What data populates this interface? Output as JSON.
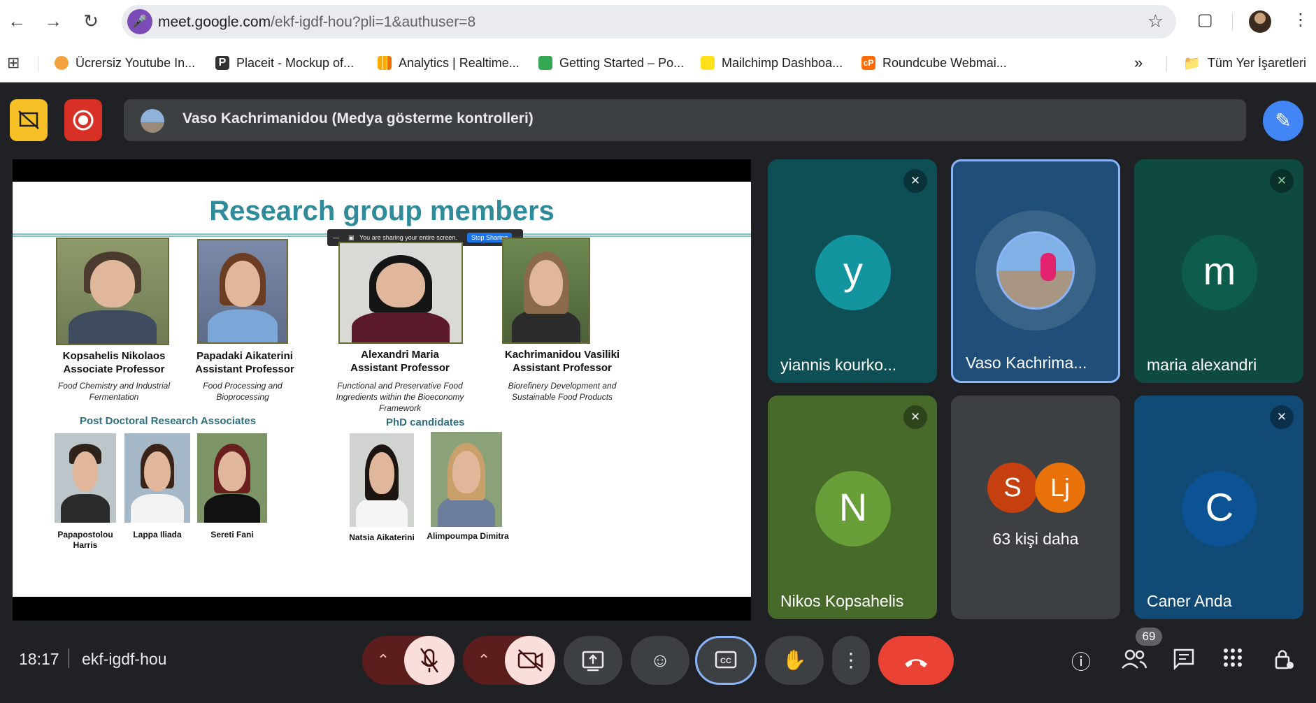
{
  "browser": {
    "url_host": "meet.google.com",
    "url_path": "/ekf-igdf-hou?pli=1&authuser=8",
    "bookmarks": [
      {
        "label": "Ücrersiz Youtube In...",
        "color": "#f4a340"
      },
      {
        "label": "Placeit - Mockup of...",
        "color": "#333333"
      },
      {
        "label": "Analytics | Realtime...",
        "color": "#f9ab00"
      },
      {
        "label": "Getting Started – Po...",
        "color": "#34a853"
      },
      {
        "label": "Mailchimp Dashboa...",
        "color": "#ffe01b"
      },
      {
        "label": "Roundcube Webmai...",
        "color": "#ff6b00"
      }
    ],
    "all_bookmarks": "Tüm Yer İşaretleri"
  },
  "meet": {
    "banner_text": "Vaso Kachrimanidou (Medya gösterme kontrolleri)",
    "slide": {
      "title": "Research group members",
      "share_notice": "You are sharing your entire screen.",
      "stop_sharing": "Stop Sharing",
      "professors": [
        {
          "name": "Kopsahelis Nikolaos",
          "title": "Associate Professor",
          "field": "Food Chemistry and Industrial Fermentation"
        },
        {
          "name": "Papadaki Aikaterini",
          "title": "Assistant Professor",
          "field": "Food Processing and Bioprocessing"
        },
        {
          "name": "Alexandri Maria",
          "title": "Assistant Professor",
          "field": "Functional and Preservative Food Ingredients within the Bioeconomy Framework"
        },
        {
          "name": "Kachrimanidou Vasiliki",
          "title": "Assistant Professor",
          "field": "Biorefinery Development and Sustainable Food Products"
        }
      ],
      "postdoc_heading": "Post Doctoral Research Associates",
      "postdocs": [
        "Papapostolou Harris",
        "Lappa Iliada",
        "Sereti Fani"
      ],
      "phd_heading": "PhD candidates",
      "phds": [
        "Natsia Aikaterini",
        "Alimpoumpa Dimitra"
      ]
    },
    "tiles": [
      {
        "name": "yiannis kourko...",
        "initial": "y",
        "bg": "#0e4f56",
        "avatar": "#12959f"
      },
      {
        "name": "Vaso Kachrima...",
        "initial": "",
        "bg": "#1f4e78",
        "avatar": "#7fa7c9"
      },
      {
        "name": "maria alexandri",
        "initial": "m",
        "bg": "#0e4a3f",
        "avatar": "#0d5c4c"
      },
      {
        "name": "Nikos Kopsahelis",
        "initial": "N",
        "bg": "#476a2a",
        "avatar": "#689f38"
      },
      {
        "name": "63 kişi daha",
        "initial_a": "S",
        "initial_b": "Lj",
        "bg": "#3c4043"
      },
      {
        "name": "Caner Anda",
        "initial": "C",
        "bg": "#114a75",
        "avatar": "#0b5394"
      }
    ],
    "time": "18:17",
    "meeting_code": "ekf-igdf-hou",
    "participant_count": "69"
  },
  "icons": {
    "back": "back-arrow-icon",
    "forward": "forward-arrow-icon",
    "reload": "reload-icon",
    "mic": "mic-icon",
    "star": "bookmark-star-icon",
    "extensions": "extensions-icon",
    "menu": "more-vert-icon"
  }
}
